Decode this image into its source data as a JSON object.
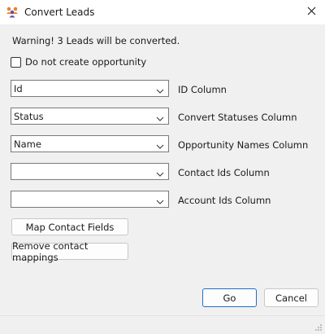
{
  "window": {
    "title": "Convert Leads",
    "icon": "leads-people-icon",
    "close_icon": "close-icon"
  },
  "warning_text": "Warning! 3 Leads will be converted.",
  "checkbox": {
    "label": "Do not create opportunity",
    "checked": false
  },
  "fields": [
    {
      "value": "Id",
      "label": "ID Column"
    },
    {
      "value": "Status",
      "label": "Convert Statuses Column"
    },
    {
      "value": "Name",
      "label": "Opportunity Names Column"
    },
    {
      "value": "",
      "label": "Contact Ids Column"
    },
    {
      "value": "",
      "label": "Account Ids Column"
    }
  ],
  "buttons": {
    "map_contact_fields": "Map Contact Fields",
    "remove_contact_mappings": "Remove contact mappings",
    "go": "Go",
    "cancel": "Cancel"
  },
  "colors": {
    "primary_border": "#1e6fc6",
    "icon_orange": "#e8842c",
    "icon_purple": "#6b4fa0"
  }
}
